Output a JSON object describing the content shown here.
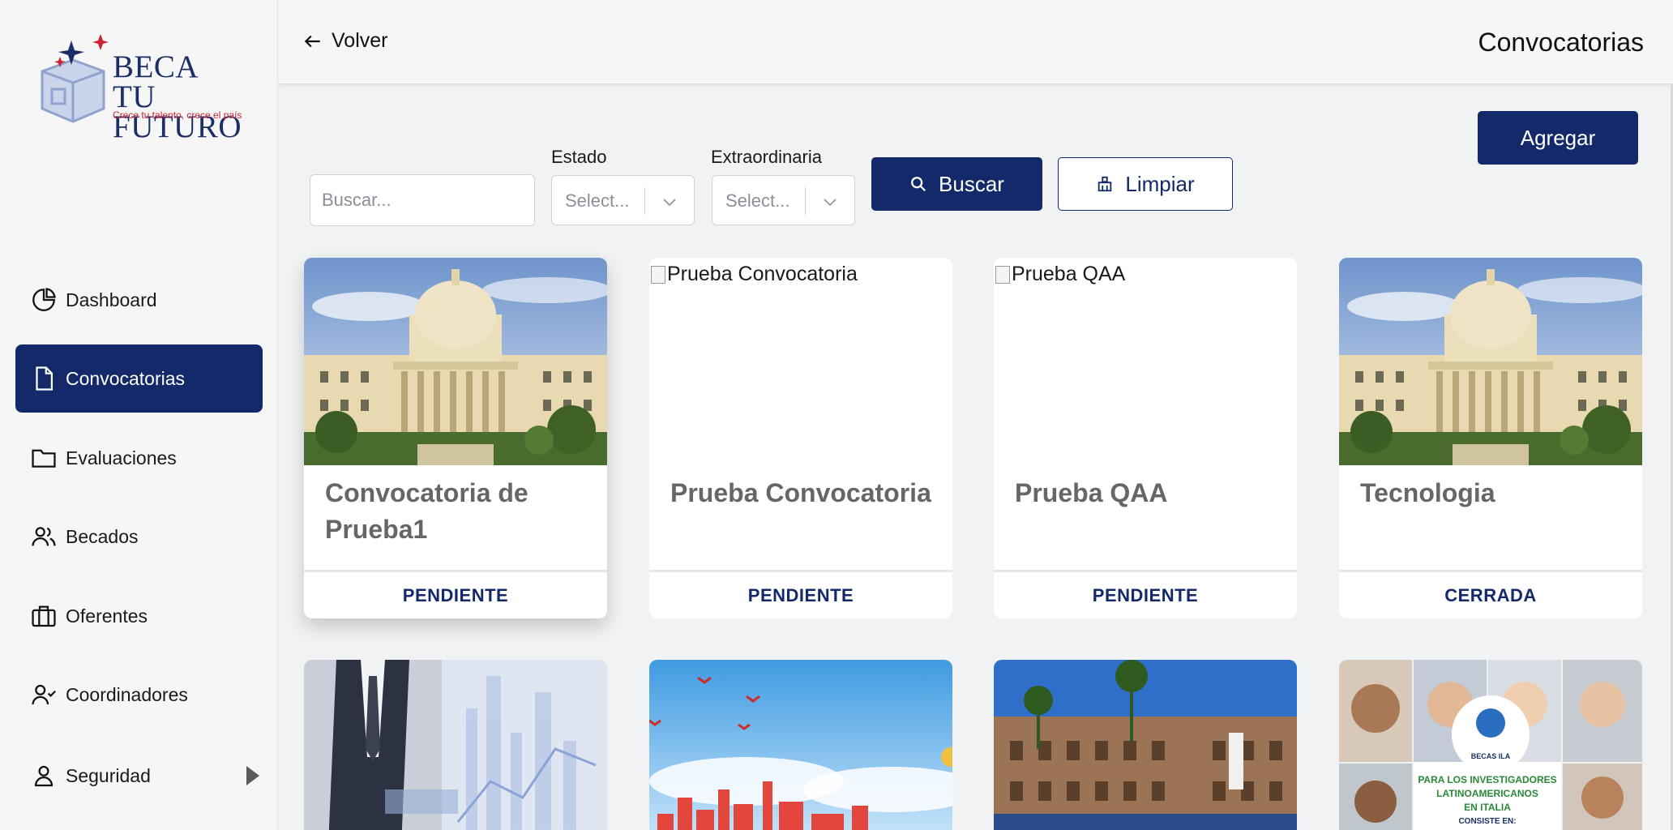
{
  "brand": {
    "title": "BECA TU FUTURO",
    "title_line1": "BECA TU",
    "title_line2": "FUTURO",
    "tagline": "Crece tu talento, crece el país",
    "colors": {
      "primary": "#13296a",
      "accent": "#cc2233"
    }
  },
  "sidebar": {
    "items": [
      {
        "label": "Dashboard",
        "icon": "pie-chart-icon",
        "active": false
      },
      {
        "label": "Convocatorias",
        "icon": "document-icon",
        "active": true
      },
      {
        "label": "Evaluaciones",
        "icon": "folder-icon",
        "active": false
      },
      {
        "label": "Becados",
        "icon": "users-icon",
        "active": false
      },
      {
        "label": "Oferentes",
        "icon": "briefcase-icon",
        "active": false
      },
      {
        "label": "Coordinadores",
        "icon": "user-check-icon",
        "active": false
      },
      {
        "label": "Seguridad",
        "icon": "user-icon",
        "active": false,
        "expandable": true
      }
    ]
  },
  "header": {
    "back_label": "Volver",
    "title": "Convocatorias"
  },
  "filters": {
    "search_placeholder": "Buscar...",
    "estado_label": "Estado",
    "estado_value": "Select...",
    "extraordinaria_label": "Extraordinaria",
    "extraordinaria_value": "Select...",
    "buscar_label": "Buscar",
    "limpiar_label": "Limpiar"
  },
  "actions": {
    "agregar_label": "Agregar"
  },
  "cards": [
    {
      "title": "Convocatoria de Prueba1",
      "status": "PENDIENTE",
      "image": "palace-photo"
    },
    {
      "title": "Prueba Convocatoria",
      "status": "PENDIENTE",
      "image_alt": "Prueba Convocatoria",
      "image": "broken"
    },
    {
      "title": "Prueba QAA",
      "status": "PENDIENTE",
      "image_alt": "Prueba QAA",
      "image": "broken"
    },
    {
      "title": "Tecnologia",
      "status": "CERRADA",
      "image": "palace-photo"
    },
    {
      "title": "",
      "status": "",
      "image": "business-photo"
    },
    {
      "title": "",
      "status": "",
      "image": "city-illustration"
    },
    {
      "title": "",
      "status": "",
      "image": "building-photo"
    },
    {
      "title": "",
      "status": "",
      "image": "students-collage",
      "poster_logo": "BECAS ILA",
      "poster_text_1": "PARA LOS INVESTIGADORES",
      "poster_text_2": "LATINOAMERICANOS",
      "poster_text_3": "EN ITALIA",
      "poster_text_4": "CONSISTE EN:"
    }
  ]
}
